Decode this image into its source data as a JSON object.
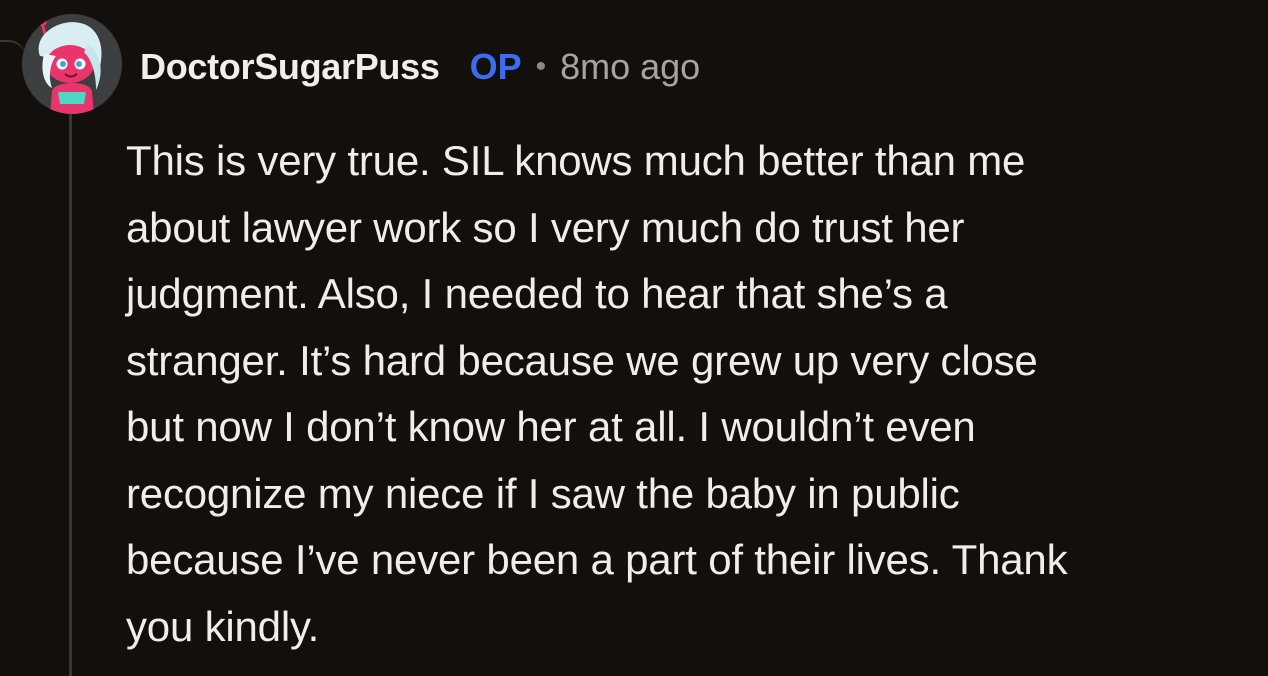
{
  "comment": {
    "username": "DoctorSugarPuss",
    "op_badge": "OP",
    "separator": "•",
    "timestamp": "8mo ago",
    "lines": [
      "This is very true. SIL knows much better than me",
      "about lawyer work so I very much do trust her",
      "judgment. Also, I needed to hear that she’s a",
      "stranger. It’s hard because we grew up very close",
      "but now I don’t know her at all. I wouldn’t even",
      "recognize my niece if I saw the baby in public",
      "because I’ve never been a part of their lives. Thank",
      "you kindly."
    ]
  },
  "avatar": {
    "icon": "snoo-avatar-pink-icon",
    "background_color": "#3c3e40",
    "skin_color": "#e8356b",
    "hair_color": "#d9eef2"
  },
  "colors": {
    "background": "#130f0d",
    "username": "#f2eeea",
    "op_badge": "#3a6df0",
    "timestamp": "#a8a39f",
    "body_text": "#f1edea",
    "thread_line": "#3b3733"
  }
}
